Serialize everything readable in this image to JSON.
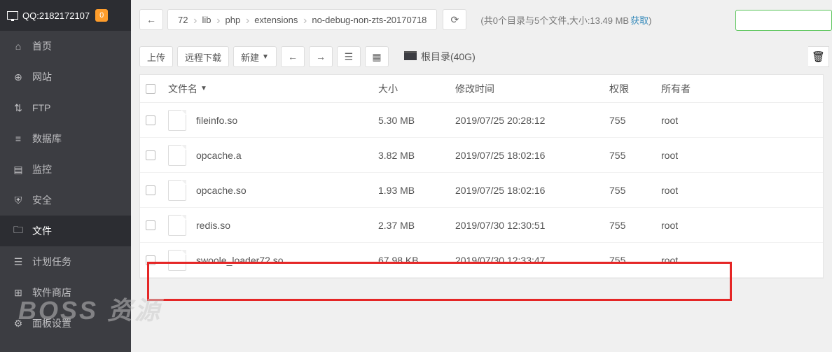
{
  "header": {
    "qq": "QQ:2182172107",
    "badge": "0"
  },
  "nav": [
    {
      "name": "home",
      "label": "首页",
      "icon": "home"
    },
    {
      "name": "site",
      "label": "网站",
      "icon": "globe"
    },
    {
      "name": "ftp",
      "label": "FTP",
      "icon": "ftp"
    },
    {
      "name": "db",
      "label": "数据库",
      "icon": "db"
    },
    {
      "name": "monitor",
      "label": "监控",
      "icon": "monitor"
    },
    {
      "name": "security",
      "label": "安全",
      "icon": "shield"
    },
    {
      "name": "files",
      "label": "文件",
      "icon": "folder",
      "active": true
    },
    {
      "name": "cron",
      "label": "计划任务",
      "icon": "cron"
    },
    {
      "name": "soft",
      "label": "软件商店",
      "icon": "soft"
    },
    {
      "name": "panel",
      "label": "面板设置",
      "icon": "panel"
    }
  ],
  "breadcrumb": [
    "72",
    "lib",
    "php",
    "extensions",
    "no-debug-non-zts-20170718"
  ],
  "pathinfo": {
    "left": "(共0个目录与5个文件,大小:13.49 MB",
    "get": "获取",
    "right": ")"
  },
  "toolbar": {
    "upload": "上传",
    "remote": "远程下载",
    "new": "新建",
    "root": "根目录(40G)"
  },
  "columns": {
    "name": "文件名",
    "size": "大小",
    "time": "修改时间",
    "perm": "权限",
    "owner": "所有者"
  },
  "files": [
    {
      "name": "fileinfo.so",
      "size": "5.30 MB",
      "time": "2019/07/25 20:28:12",
      "perm": "755",
      "owner": "root"
    },
    {
      "name": "opcache.a",
      "size": "3.82 MB",
      "time": "2019/07/25 18:02:16",
      "perm": "755",
      "owner": "root"
    },
    {
      "name": "opcache.so",
      "size": "1.93 MB",
      "time": "2019/07/25 18:02:16",
      "perm": "755",
      "owner": "root"
    },
    {
      "name": "redis.so",
      "size": "2.37 MB",
      "time": "2019/07/30 12:30:51",
      "perm": "755",
      "owner": "root"
    },
    {
      "name": "swoole_loader72.so",
      "size": "67.98 KB",
      "time": "2019/07/30 12:33:47",
      "perm": "755",
      "owner": "root"
    }
  ],
  "watermark": "BOSS 资源"
}
